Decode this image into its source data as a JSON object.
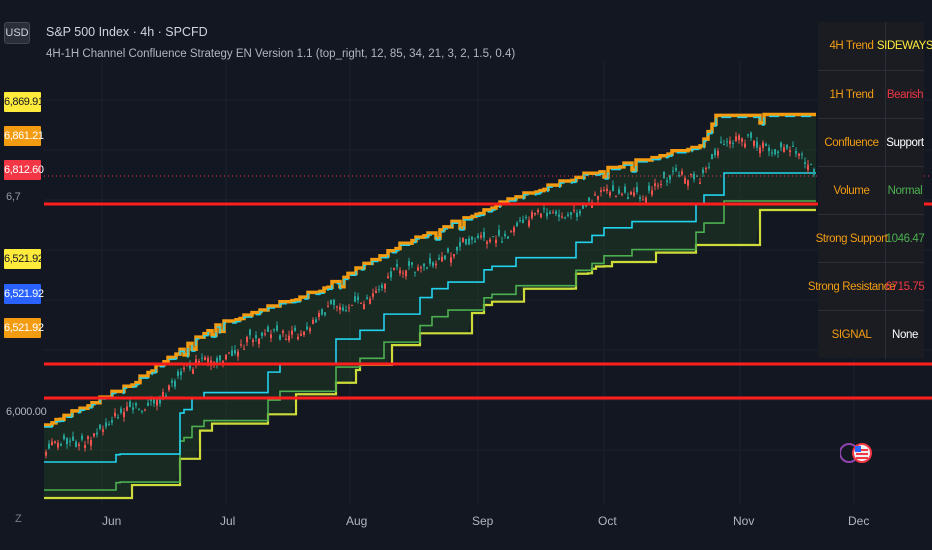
{
  "header": {
    "currency": "USD",
    "symbol_line": "S&P 500 Index · 4h · SPCFD",
    "indicator_line": "4H-1H Channel Confluence Strategy EN Version 1.1 (top_right, 12, 85, 34, 21, 3, 2, 1.5, 0.4)"
  },
  "price_badges": [
    {
      "text": "6,869.91",
      "bg": "#ffeb3b",
      "fg": "#131722"
    },
    {
      "text": "6,861.21",
      "bg": "#f39c12",
      "fg": "#ffffff"
    },
    {
      "text": "6,812.60",
      "bg": "#f23645",
      "fg": "#ffffff"
    },
    {
      "text": "6,521.92",
      "bg": "#ffeb3b",
      "fg": "#131722"
    },
    {
      "text": "6,521.92",
      "bg": "#2962ff",
      "fg": "#ffffff"
    },
    {
      "text": "6,521.92",
      "bg": "#f39c12",
      "fg": "#ffffff"
    }
  ],
  "y_axis": {
    "ticks": [
      "6,000.00"
    ]
  },
  "x_axis": {
    "ticks": [
      "Jun",
      "Jul",
      "Aug",
      "Sep",
      "Oct",
      "Nov",
      "Dec"
    ]
  },
  "timezone_toggle": "Z",
  "status_table": {
    "rows": [
      {
        "label": "4H Trend",
        "value": "SIDEWAYS",
        "value_color": "#ffeb3b"
      },
      {
        "label": "1H Trend",
        "value": "Bearish",
        "value_color": "#f23645"
      },
      {
        "label": "Confluence",
        "value": "Support",
        "value_color": "#ffffff"
      },
      {
        "label": "Volume",
        "value": "Normal",
        "value_color": "#4caf50"
      },
      {
        "label": "Strong Support",
        "value": "1046.47",
        "value_color": "#4caf50"
      },
      {
        "label": "Strong Resistance",
        "value": "6715.75",
        "value_color": "#f23645"
      },
      {
        "label": "SIGNAL",
        "value": "None",
        "value_color": "#ffffff"
      }
    ]
  },
  "colors": {
    "background": "#131722",
    "upper_channel": "#f39c12",
    "mid_channel": "#22d3ee",
    "lower_channel": "#cddc39",
    "horizontal_lines": "#ff1e1e",
    "candle_up": "#26a69a",
    "candle_down": "#ef5350"
  },
  "icons": {
    "logo": "tradingview-flag-logo-icon"
  }
}
